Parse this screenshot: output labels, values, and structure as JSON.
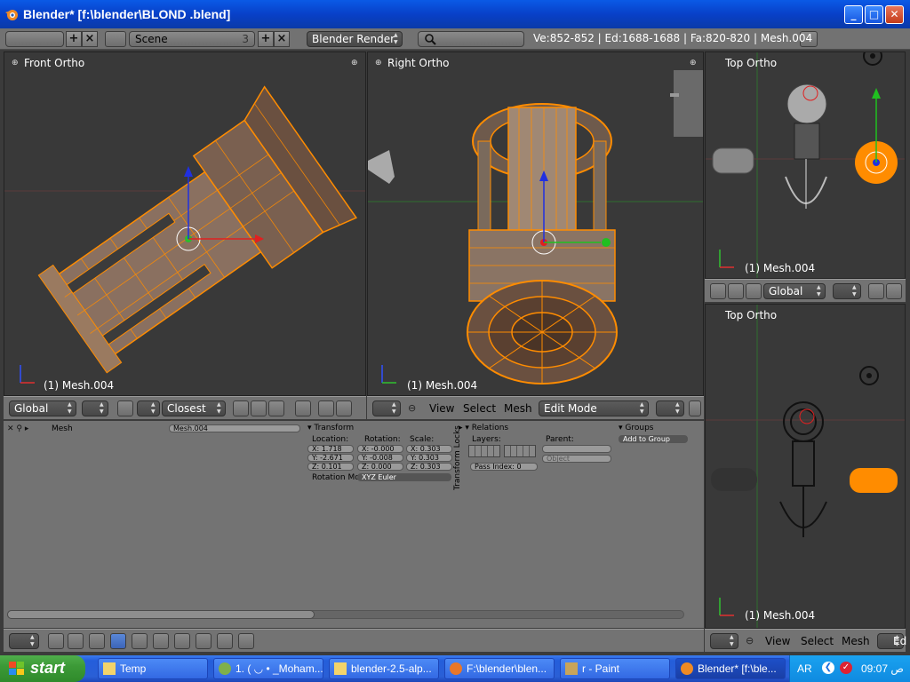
{
  "window": {
    "title": "Blender* [f:\\blender\\BLOND .blend]"
  },
  "infobar": {
    "scene_name": "Scene",
    "scene_users": "3",
    "render_engine": "Blender Render",
    "stats": "Ve:852-852 | Ed:1688-1688 | Fa:820-820 | Mesh.004"
  },
  "viewports": {
    "front": {
      "label": "Front Ortho",
      "object": "(1) Mesh.004"
    },
    "right": {
      "label": "Right Ortho",
      "object": "(1) Mesh.004"
    },
    "top1": {
      "label": "Top Ortho",
      "object": "(1) Mesh.004"
    },
    "top2": {
      "label": "Top Ortho",
      "object": "(1) Mesh.004"
    }
  },
  "front_header": {
    "orientation": "Global",
    "snap": "Closest"
  },
  "right_header": {
    "menu_view": "View",
    "menu_select": "Select",
    "menu_mesh": "Mesh",
    "mode": "Edit Mode"
  },
  "top1_header": {
    "orientation": "Global"
  },
  "top2_header": {
    "menu_view": "View",
    "menu_select": "Select",
    "menu_mesh": "Mesh",
    "mode_partial": "Ed"
  },
  "props": {
    "breadcrumb": "Mesh",
    "object_name": "Mesh.004",
    "transform": {
      "title": "Transform",
      "location_label": "Location:",
      "rotation_label": "Rotation:",
      "scale_label": "Scale:",
      "loc": [
        "X: 1.718",
        "Y: -2.671",
        "Z: 0.101"
      ],
      "rot": [
        "X: -0.000",
        "Y: -0.008",
        "Z: 0.000"
      ],
      "scale": [
        "X: 0.303",
        "Y: 0.303",
        "Z: 0.303"
      ],
      "rotation_mode_label": "Rotation Mod",
      "rotation_mode": "XYZ Euler",
      "locks_label": "Transform Locks"
    },
    "relations": {
      "title": "Relations",
      "layers_label": "Layers:",
      "parent_label": "Parent:",
      "pass_index": "Pass Index: 0",
      "parent_type": "Object"
    },
    "groups": {
      "title": "Groups",
      "add_button": "Add to Group"
    }
  },
  "taskbar": {
    "start": "start",
    "tasks": [
      {
        "label": "Temp",
        "icon": "folder-icon"
      },
      {
        "label": "1. ( ◡ • _Moham...",
        "icon": "chat-icon"
      },
      {
        "label": "blender-2.5-alp...",
        "icon": "folder-icon"
      },
      {
        "label": "F:\\blender\\blen...",
        "icon": "firefox-icon"
      },
      {
        "label": "r - Paint",
        "icon": "paint-icon"
      },
      {
        "label": "Blender* [f:\\ble...",
        "icon": "blender-icon"
      }
    ],
    "language": "AR",
    "clock": "09:07 ص"
  },
  "colors": {
    "selection_orange": "#ff8c00",
    "viewport_bg": "#393939",
    "header_gray": "#737373"
  }
}
